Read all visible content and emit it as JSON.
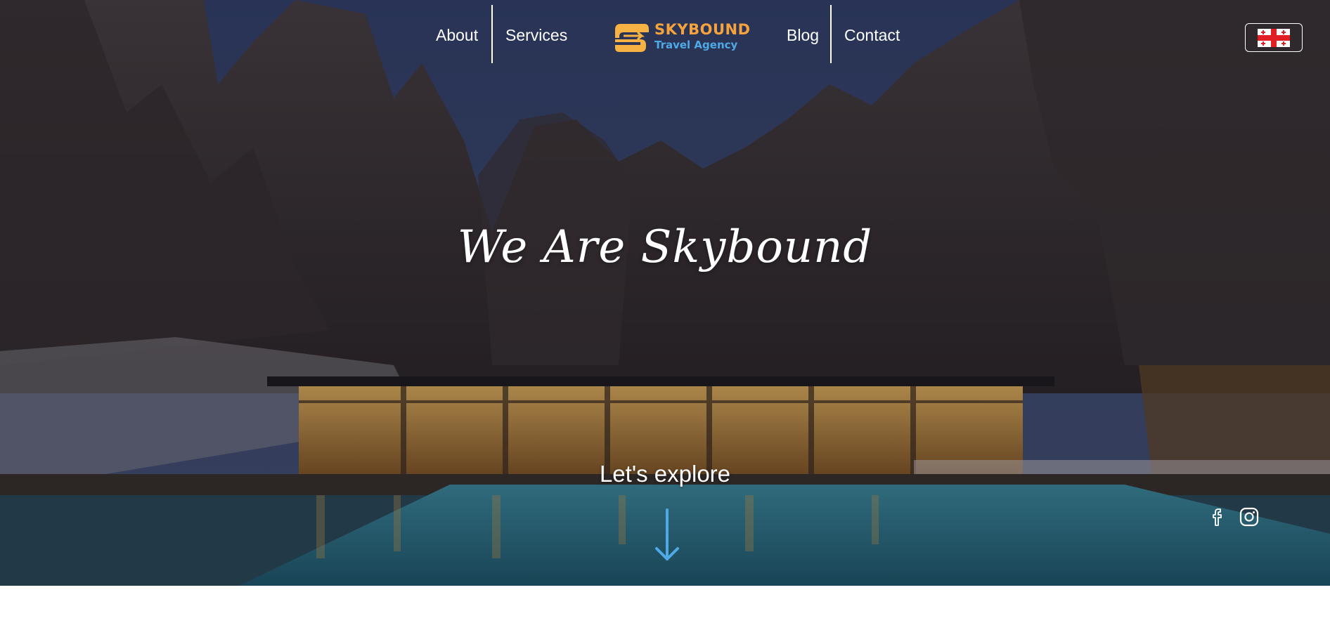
{
  "nav": {
    "left_links": [
      {
        "label": "About"
      },
      {
        "label": "Services"
      }
    ],
    "right_links": [
      {
        "label": "Blog"
      },
      {
        "label": "Contact"
      }
    ]
  },
  "logo": {
    "title": "SKYBOUND",
    "subtitle": "Travel Agency",
    "icon": "logo-mark-icon",
    "colors": {
      "orange": "#f7a33d",
      "blue": "#4ea9e6"
    }
  },
  "language": {
    "icon": "georgia-flag-icon",
    "colors": {
      "red": "#e01e24",
      "white": "#ffffff"
    }
  },
  "hero": {
    "title": "We Are Skybound",
    "subtitle": "Let's explore",
    "arrow_icon": "arrow-down-icon",
    "arrow_color": "#4ea9e6"
  },
  "social": [
    {
      "icon": "facebook-icon"
    },
    {
      "icon": "instagram-icon"
    }
  ]
}
